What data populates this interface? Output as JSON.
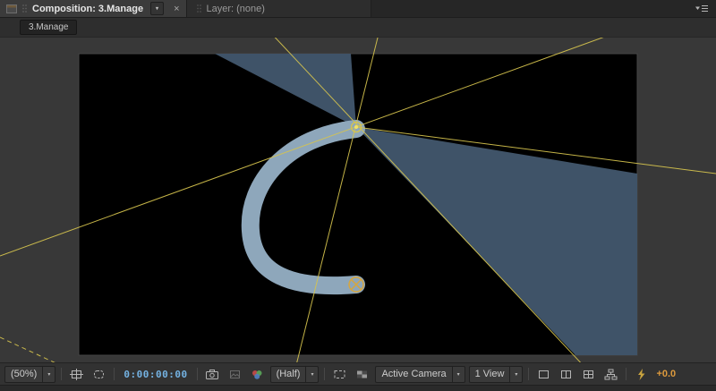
{
  "panel": {
    "tabs": [
      {
        "label": "Composition: 3.Manage"
      },
      {
        "label": "Layer: (none)"
      }
    ],
    "nav_button": "3.Manage"
  },
  "toolbar": {
    "zoom": "(50%)",
    "timecode": "0:00:00:00",
    "resolution": "(Half)",
    "camera_view": "Active Camera",
    "view_layout": "1 View",
    "exposure": "+0.0"
  },
  "icons": {
    "chevron_down": "▾",
    "close": "×"
  },
  "colors": {
    "selection_yellow": "#d6c44e",
    "marker_orange": "#d8a63c",
    "wedge_slate": "#3f5368",
    "curve": "#8ea7bb",
    "comp_background": "#000000",
    "timecode_blue": "#74b2e2",
    "exposure_orange": "#dd9a3d"
  }
}
